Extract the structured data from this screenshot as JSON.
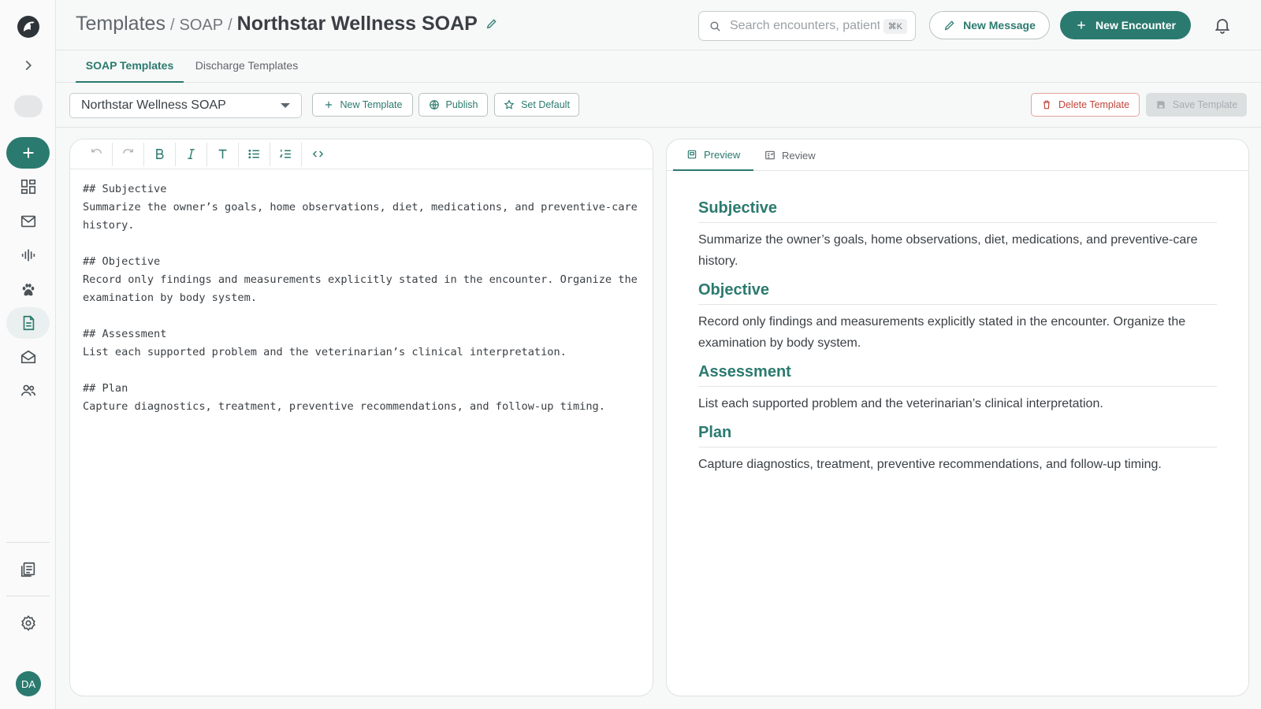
{
  "header": {
    "breadcrumb": {
      "root": "Templates",
      "sep1": "/",
      "mid": "SOAP",
      "sep2": "/",
      "current": "Northstar Wellness SOAP"
    },
    "search": {
      "placeholder": "Search encounters, patients...",
      "shortcut": "⌘K"
    },
    "new_message_label": "New Message",
    "new_encounter_label": "New Encounter"
  },
  "tabs": [
    {
      "label": "SOAP Templates",
      "active": true
    },
    {
      "label": "Discharge Templates",
      "active": false
    }
  ],
  "toolbar": {
    "selected_template": "Northstar Wellness SOAP",
    "new_template_label": "New Template",
    "publish_label": "Publish",
    "set_default_label": "Set Default",
    "delete_label": "Delete Template",
    "save_label": "Save Template"
  },
  "editor": {
    "content": "## Subjective\nSummarize the owner’s goals, home observations, diet, medications, and preventive-care history.\n\n## Objective\nRecord only findings and measurements explicitly stated in the encounter. Organize the examination by body system.\n\n## Assessment\nList each supported problem and the veterinarian’s clinical interpretation.\n\n## Plan\nCapture diagnostics, treatment, preventive recommendations, and follow-up timing."
  },
  "preview": {
    "tabs": [
      {
        "label": "Preview",
        "active": true
      },
      {
        "label": "Review",
        "active": false
      }
    ],
    "sections": [
      {
        "heading": "Subjective",
        "body": "Summarize the owner’s goals, home observations, diet, medications, and preventive-care history."
      },
      {
        "heading": "Objective",
        "body": "Record only findings and measurements explicitly stated in the encounter. Organize the examination by body system."
      },
      {
        "heading": "Assessment",
        "body": "List each supported problem and the veterinarian’s clinical interpretation."
      },
      {
        "heading": "Plan",
        "body": "Capture diagnostics, treatment, preventive recommendations, and follow-up timing."
      }
    ]
  },
  "user": {
    "initials": "DA"
  },
  "colors": {
    "accent": "#2b7a6f",
    "danger": "#c0453b"
  }
}
